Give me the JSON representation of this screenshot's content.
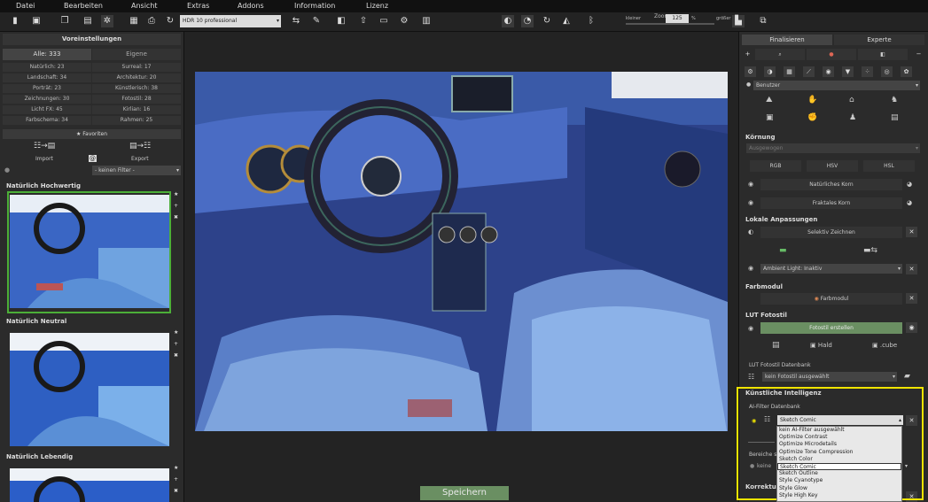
{
  "menubar": {
    "items": [
      "Datei",
      "Bearbeiten",
      "Ansicht",
      "Extras",
      "Addons",
      "Information",
      "Lizenz"
    ]
  },
  "toolbar": {
    "preset_value": "HDR 10 professional",
    "zoom_label": "Zoom",
    "zoom_value": "125",
    "zoom_unit": "%",
    "zoom_small": "kleiner",
    "zoom_large": "größer"
  },
  "left_panel": {
    "title": "Voreinstellungen",
    "tabs": [
      "Alle: 333",
      "Eigene"
    ],
    "categories": [
      [
        "Natürlich: 23",
        "Surreal: 17"
      ],
      [
        "Landschaft: 34",
        "Architektur: 20"
      ],
      [
        "Porträt: 23",
        "Künstlerisch: 38"
      ],
      [
        "Zeichnungen: 30",
        "Fotostil: 28"
      ],
      [
        "Licht FX: 45",
        "Kirlian: 16"
      ],
      [
        "Farbschema: 34",
        "Rahmen: 25"
      ]
    ],
    "favorites": "★ Favoriten",
    "import_label": "Import",
    "export_label": "Export",
    "filter_value": "- keinen Filter -",
    "sections": [
      "Natürlich Hochwertig",
      "Natürlich Neutral",
      "Natürlich Lebendig"
    ]
  },
  "canvas": {
    "save_label": "Speichern"
  },
  "right_panel": {
    "tabs": [
      "Finalisieren",
      "Experte"
    ],
    "benutzer": "Benutzer",
    "koernung": {
      "title": "Körnung",
      "select_placeholder": "Ausgewogen",
      "modes": [
        "RGB",
        "HSV",
        "HSL"
      ],
      "natural_grain": "Natürliches Korn",
      "fractal_grain": "Fraktales Korn"
    },
    "lokale": {
      "title": "Lokale Anpassungen",
      "selective": "Selektiv Zeichnen",
      "ambient": "Ambient Light: Inaktiv"
    },
    "farbmodul": {
      "title": "Farbmodul",
      "label": "Farbmodul"
    },
    "lut": {
      "title": "LUT Fotostil",
      "create": "Fotostil erstellen",
      "hald": "Hald",
      "cube": ".cube",
      "db_label": "LUT Fotostil Datenbank",
      "db_value": "kein Fotostil ausgewählt"
    },
    "ki": {
      "title": "Künstliche Intelligenz",
      "db_label": "AI-Filter Datenbank",
      "selected": "Sketch Comic",
      "bereiche": "Bereiche s",
      "bereiche_value": "keine",
      "korrekturen": "Korrekture",
      "options": [
        "kein AI-Filter ausgewählt",
        "Optimize Contrast",
        "Optimize Microdetails",
        "Optimize Tone Compression",
        "Sketch Color",
        "Sketch Comic",
        "Sketch Outline",
        "Style Cyanotype",
        "Style Glow",
        "Style High Key"
      ],
      "highlight_color": "#f0e400"
    }
  },
  "colors": {
    "accent_green": "#6a8f62",
    "thumb_border": "#4caf38"
  }
}
